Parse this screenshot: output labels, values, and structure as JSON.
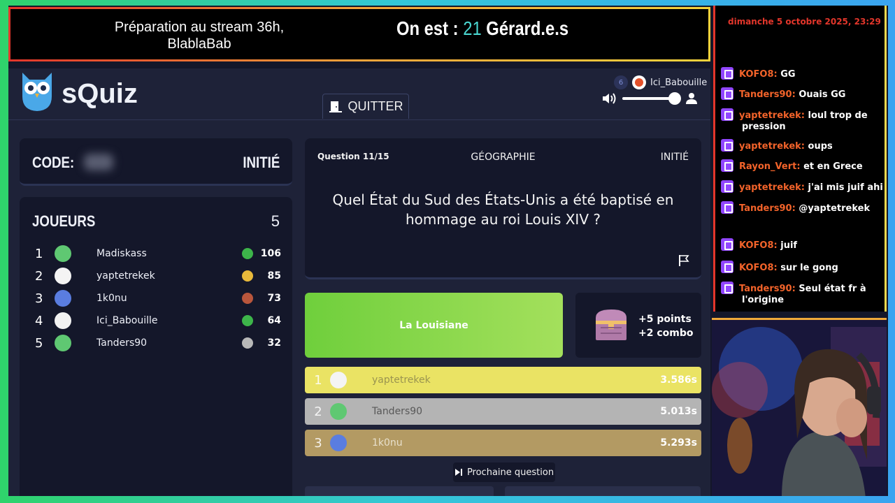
{
  "banner": {
    "left_text": "Préparation au stream 36h, BlablaBab",
    "right_prefix": "On est : ",
    "right_number": "21",
    "right_suffix": " Gérard.e.s"
  },
  "app": {
    "logo_text": "sQuiz",
    "quit_label": "QUITTER",
    "user_level": "6",
    "user_name": "Ici_Babouille",
    "volume_level": 0.92
  },
  "room": {
    "code_label": "CODE:",
    "difficulty": "INITIÉ"
  },
  "players": {
    "title": "JOUEURS",
    "count": "5",
    "list": [
      {
        "rank": "1",
        "name": "Madiskass",
        "score": "106",
        "medal_color": "#3db54a",
        "avatar_color": "#5fc872"
      },
      {
        "rank": "2",
        "name": "yaptetrekek",
        "score": "85",
        "medal_color": "#e8b93b",
        "avatar_color": "#f4f4f4"
      },
      {
        "rank": "3",
        "name": "1k0nu",
        "score": "73",
        "medal_color": "#b9563c",
        "avatar_color": "#5a7de0"
      },
      {
        "rank": "4",
        "name": "Ici_Babouille",
        "score": "64",
        "medal_color": "#3db54a",
        "avatar_color": "#f2f2f2"
      },
      {
        "rank": "5",
        "name": "Tanders90",
        "score": "32",
        "medal_color": "#b8b8b8",
        "avatar_color": "#5fc872"
      }
    ]
  },
  "question": {
    "number": "Question 11/15",
    "category": "GÉOGRAPHIE",
    "level": "INITIÉ",
    "text": "Quel État du Sud des États-Unis a été baptisé en hommage au roi Louis XIV ?"
  },
  "answer": {
    "text": "La Louisiane",
    "reward_points": "+5 points",
    "reward_combo": "+2 combo"
  },
  "ranking": [
    {
      "rank": "1",
      "name": "yaptetrekek",
      "time": "3.586s",
      "bg": "#eae364",
      "name_color": "#9a9450"
    },
    {
      "rank": "2",
      "name": "Tanders90",
      "time": "5.013s",
      "bg": "#b4b4b4",
      "name_color": "#585858"
    },
    {
      "rank": "3",
      "name": "1k0nu",
      "time": "5.293s",
      "bg": "#b39a63",
      "name_color": "#e8e0cc"
    }
  ],
  "next_label": "Prochaine question",
  "chat": {
    "date": "dimanche 5 octobre 2025, 23:29",
    "messages": [
      {
        "user": "KOFO8:",
        "text": "GG"
      },
      {
        "user": "Tanders90:",
        "text": "Ouais GG"
      },
      {
        "user": "yaptetrekek:",
        "text": "loul trop de pression"
      },
      {
        "user": "yaptetrekek:",
        "text": "oups"
      },
      {
        "user": "Rayon_Vert:",
        "text": "et en Grece"
      },
      {
        "user": "yaptetrekek:",
        "text": "j'ai mis juif ahi"
      },
      {
        "user": "Tanders90:",
        "text": "@yaptetrekek"
      },
      {
        "user": "KOFO8:",
        "text": "juif"
      },
      {
        "user": "KOFO8:",
        "text": "sur le gong"
      },
      {
        "user": "Tanders90:",
        "text": "Seul état fr à l'origine"
      }
    ]
  }
}
